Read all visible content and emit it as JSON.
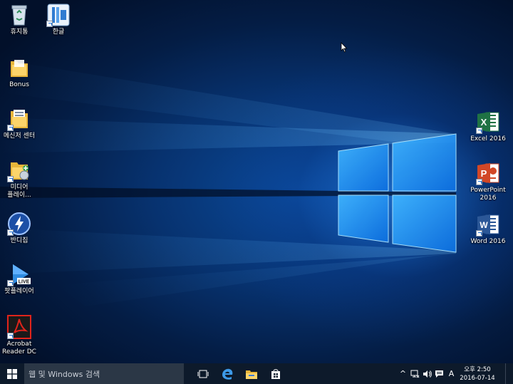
{
  "desktop": {
    "left_icons": [
      {
        "label": "휴지통",
        "icon": "recycle-bin-icon"
      },
      {
        "label": "한글",
        "icon": "hangul-app-icon"
      },
      {
        "label": "Bonus",
        "icon": "folder-icon"
      },
      {
        "label": "메신저 센터",
        "icon": "folder-icon"
      },
      {
        "label": "미디어\n플레이...",
        "icon": "media-folder-icon"
      },
      {
        "label": "반디집",
        "icon": "bandizip-icon"
      },
      {
        "label": "팟플레이어",
        "icon": "potplayer-live-icon",
        "badge": "LIVE"
      },
      {
        "label": "Acrobat\nReader DC",
        "icon": "acrobat-icon"
      }
    ],
    "right_icons": [
      {
        "label": "Excel 2016",
        "icon": "excel-icon",
        "letter": "X",
        "color": "#1f7244"
      },
      {
        "label": "PowerPoint\n2016",
        "icon": "powerpoint-icon",
        "letter": "P",
        "color": "#d24726"
      },
      {
        "label": "Word 2016",
        "icon": "word-icon",
        "letter": "W",
        "color": "#2b5797"
      }
    ]
  },
  "taskbar": {
    "search_placeholder": "웹 및 Windows 검색",
    "pinned": [
      "task-view-icon",
      "edge-icon",
      "file-explorer-icon",
      "store-icon"
    ],
    "tray": {
      "chevron": "^",
      "ime": "A",
      "time": "오후 2:50",
      "date": "2016-07-14"
    }
  },
  "colors": {
    "taskbar": "#0d1a2b",
    "search": "#2b3746",
    "accent": "#1b6fd6"
  }
}
